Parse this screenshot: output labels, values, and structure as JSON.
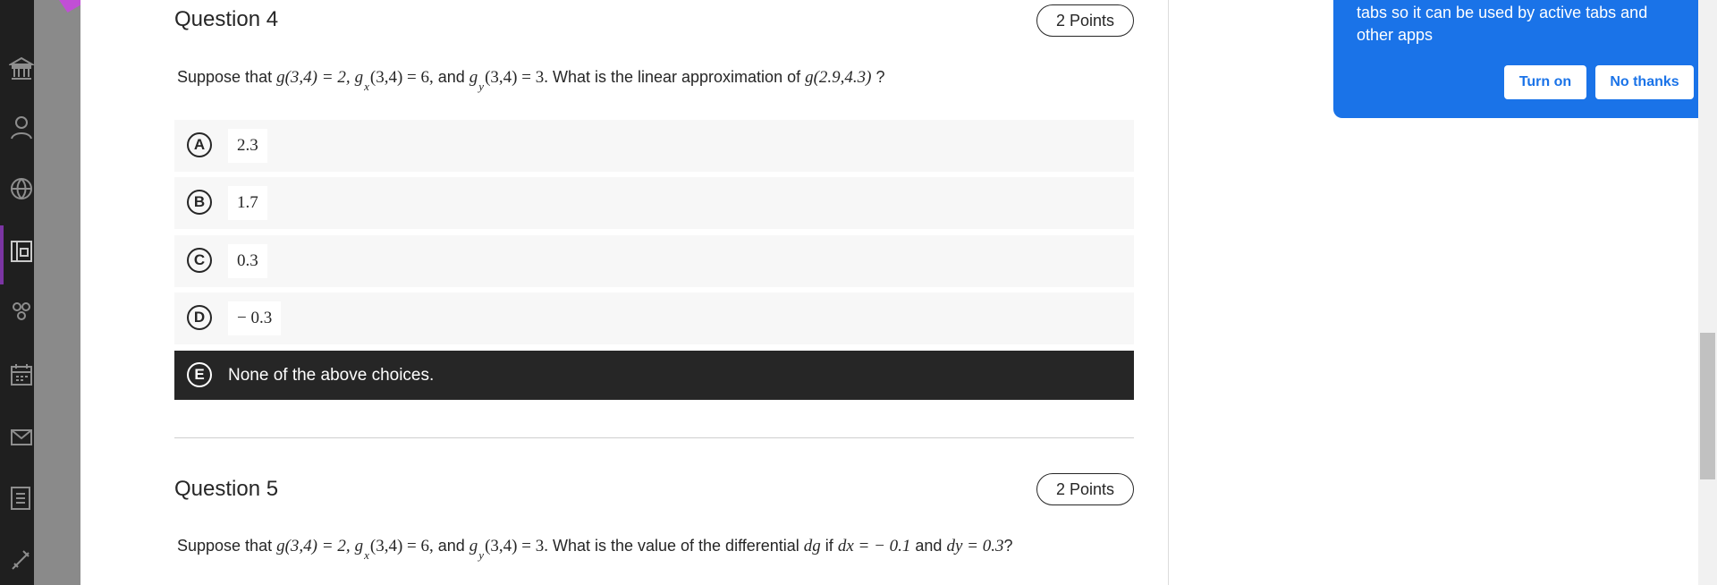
{
  "sidebar": {
    "icons": [
      "institution-icon",
      "profile-icon",
      "globe-icon",
      "courses-icon",
      "groups-icon",
      "calendar-icon",
      "messages-icon",
      "grades-icon",
      "tools-icon"
    ]
  },
  "questions": [
    {
      "title": "Question 4",
      "points": "2 Points",
      "text": {
        "prefix": "Suppose that ",
        "g_eq": "g(3,4) = 2,",
        "gx": "g",
        "gx_sub": "x",
        "gx_eq": "(3,4) = 6,",
        "and1": " and ",
        "gy": "g",
        "gy_sub": "y",
        "gy_eq": "(3,4) = 3.",
        "ask": " What is the linear approximation of ",
        "target": "g(2.9,4.3)",
        "end": " ?"
      },
      "options": [
        {
          "letter": "A",
          "value": "2.3"
        },
        {
          "letter": "B",
          "value": "1.7"
        },
        {
          "letter": "C",
          "value": "0.3"
        },
        {
          "letter": "D",
          "value": "− 0.3"
        },
        {
          "letter": "E",
          "value": "None of the above choices.",
          "selected": true
        }
      ]
    },
    {
      "title": "Question 5",
      "points": "2 Points",
      "text": {
        "prefix": "Suppose that ",
        "g_eq": "g(3,4) = 2,",
        "gx": "g",
        "gx_sub": "x",
        "gx_eq": "(3,4) = 6,",
        "and1": " and ",
        "gy": "g",
        "gy_sub": "y",
        "gy_eq": "(3,4) = 3.",
        "ask": " What is the value of the differential ",
        "dg": "dg",
        "if": " if ",
        "dx": "dx = − 0.1",
        "and2": " and ",
        "dy": "dy = 0.3",
        "end": "?"
      }
    }
  ],
  "popup": {
    "text": "tabs so it can be used by active tabs and other apps",
    "turn_on": "Turn on",
    "no_thanks": "No thanks",
    "color": "#1a73e8"
  },
  "colors": {
    "selected_option": "#262626",
    "rail": "#1f1f1f",
    "rail_accent": "#7b35a3"
  }
}
